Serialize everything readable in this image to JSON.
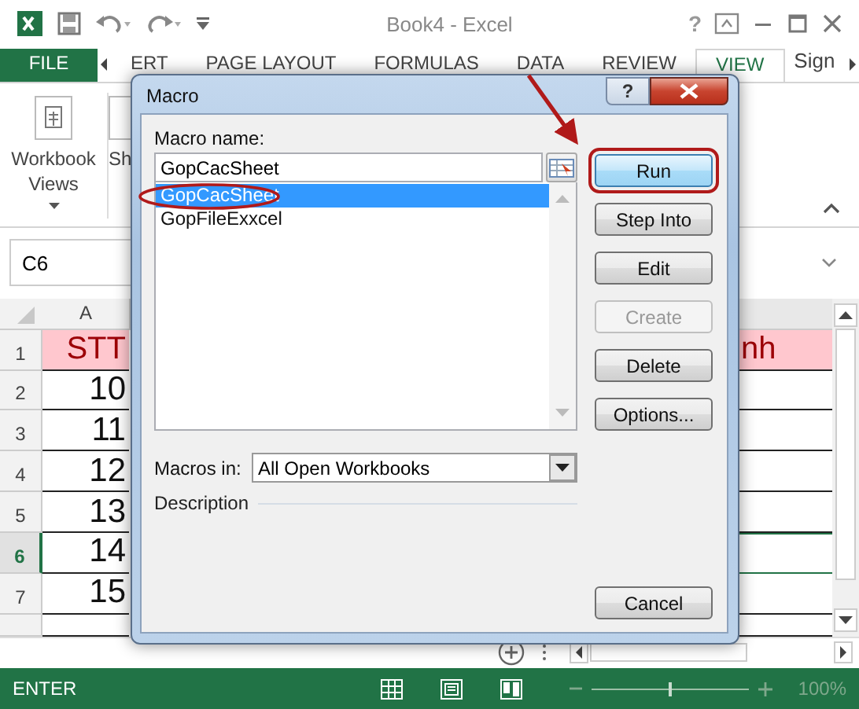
{
  "window": {
    "title": "Book4 - Excel",
    "help_glyph": "?"
  },
  "ribbon_tabs": [
    {
      "label": "FILE",
      "kind": "file",
      "selected": false
    },
    {
      "label": "ERT",
      "kind": "tab",
      "selected": false
    },
    {
      "label": "PAGE LAYOUT",
      "kind": "tab",
      "selected": false
    },
    {
      "label": "FORMULAS",
      "kind": "tab",
      "selected": false
    },
    {
      "label": "DATA",
      "kind": "tab",
      "selected": false
    },
    {
      "label": "REVIEW",
      "kind": "tab",
      "selected": false
    },
    {
      "label": "VIEW",
      "kind": "tab",
      "selected": true
    },
    {
      "label": "Sign",
      "kind": "account",
      "selected": false
    }
  ],
  "ribbon": {
    "groups": [
      {
        "label": "Workbook Views",
        "kind": "dropdown"
      },
      {
        "label": "Sh",
        "kind": "cut"
      }
    ]
  },
  "name_box": "C6",
  "sheet": {
    "columns": [
      "A"
    ],
    "rows": [
      {
        "header": "1",
        "kind": "title",
        "selected": false,
        "cells": [
          "STT",
          "nh"
        ]
      },
      {
        "header": "2",
        "kind": "data",
        "selected": false,
        "cells": [
          "10",
          ""
        ]
      },
      {
        "header": "3",
        "kind": "data",
        "selected": false,
        "cells": [
          "11",
          ""
        ]
      },
      {
        "header": "4",
        "kind": "data",
        "selected": false,
        "cells": [
          "12",
          ""
        ]
      },
      {
        "header": "5",
        "kind": "data",
        "selected": false,
        "cells": [
          "13",
          ""
        ]
      },
      {
        "header": "6",
        "kind": "data",
        "selected": true,
        "cells": [
          "14",
          ""
        ]
      },
      {
        "header": "7",
        "kind": "data",
        "selected": false,
        "cells": [
          "15",
          ""
        ]
      }
    ]
  },
  "status_bar": {
    "mode": "ENTER",
    "zoom": "100%",
    "zoom_slider": {
      "level": 0.5
    }
  },
  "dialog": {
    "title": "Macro",
    "help_glyph": "?",
    "name_label": "Macro name:",
    "name_value": "GopCacSheet",
    "macros": [
      {
        "label": "GopCacSheet",
        "selected": true
      },
      {
        "label": "GopFileExxcel",
        "selected": false
      }
    ],
    "buttons": [
      {
        "label": "Run",
        "disabled": false,
        "highlighted": true
      },
      {
        "label": "Step Into",
        "disabled": false,
        "highlighted": false
      },
      {
        "label": "Edit",
        "disabled": false,
        "highlighted": false
      },
      {
        "label": "Create",
        "disabled": true,
        "highlighted": false
      },
      {
        "label": "Delete",
        "disabled": false,
        "highlighted": false
      },
      {
        "label": "Options...",
        "disabled": false,
        "highlighted": false
      }
    ],
    "cancel": "Cancel",
    "macros_in_label": "Macros in:",
    "macros_in_value": "All Open Workbooks",
    "description_label": "Description"
  }
}
